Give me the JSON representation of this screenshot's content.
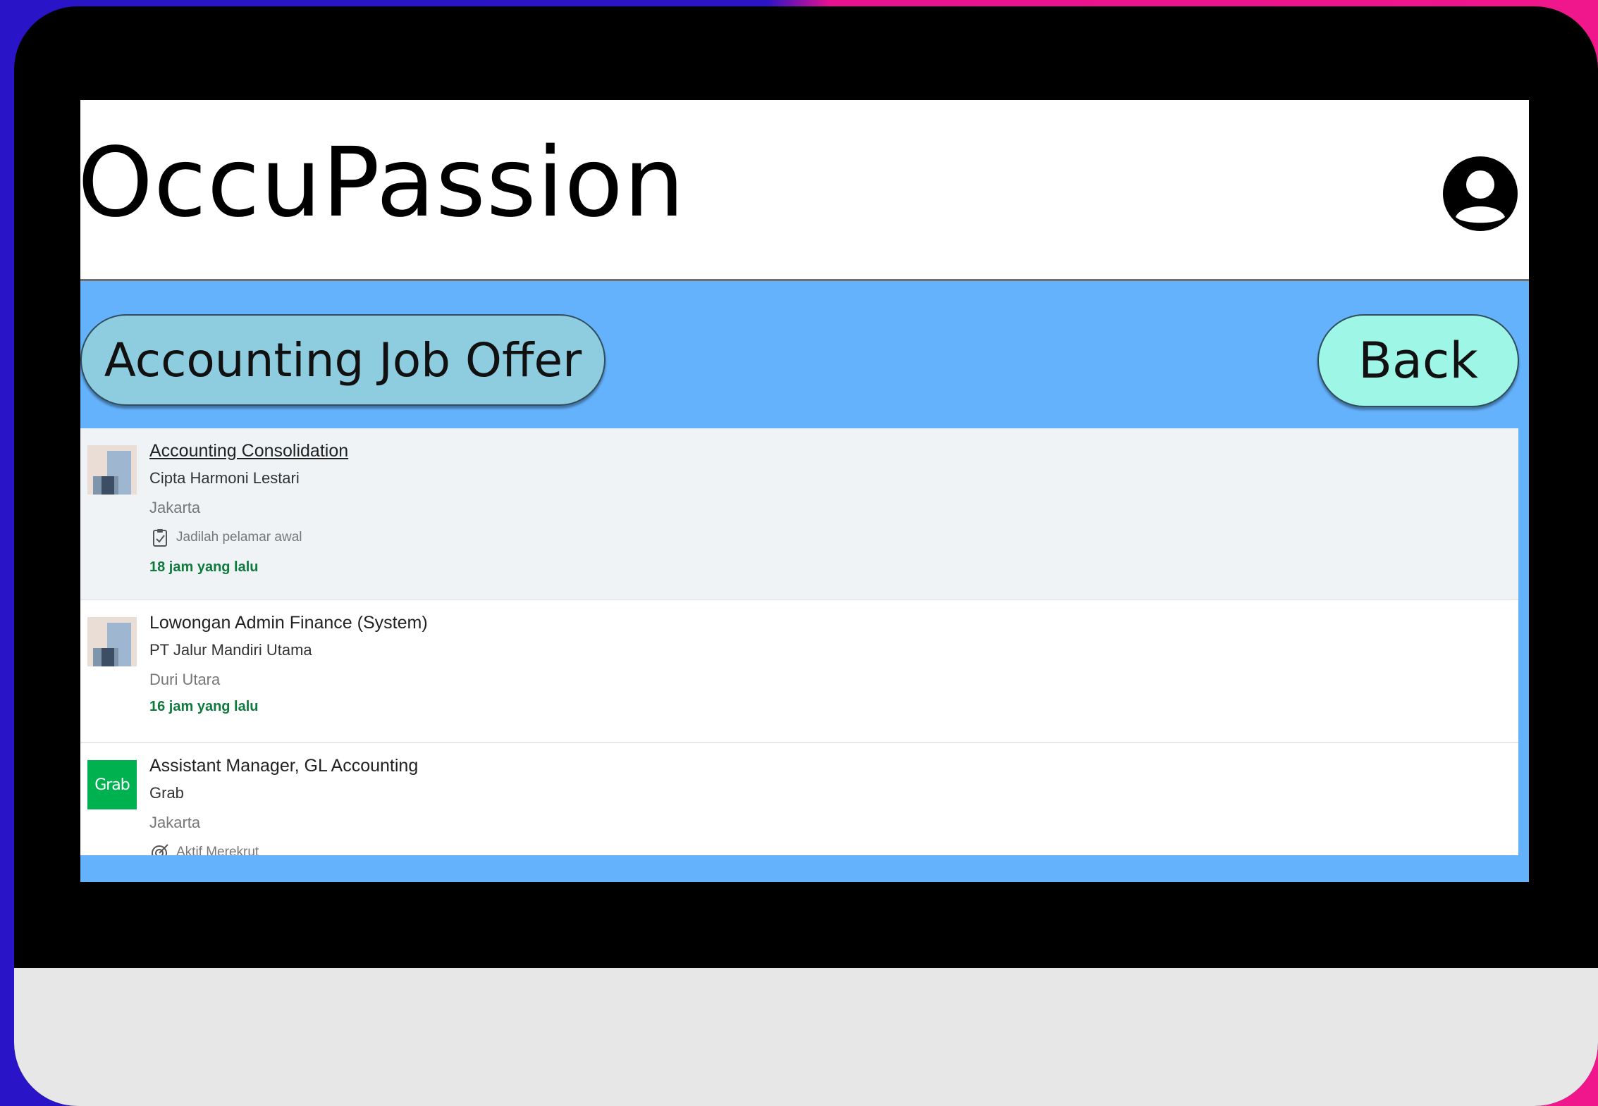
{
  "app": {
    "brand": "OccuPassion",
    "profile_icon": "user-circle-icon"
  },
  "page": {
    "title": "Accounting Job Offer",
    "back_label": "Back"
  },
  "jobs": [
    {
      "title": "Accounting Consolidation",
      "company": "Cipta Harmoni Lestari",
      "location": "Jakarta",
      "insight": "Jadilah pelamar awal",
      "insight_icon": "clipboard-check-icon",
      "posted": "18 jam yang lalu",
      "logo": "building-logo"
    },
    {
      "title": "Lowongan Admin Finance (System)",
      "company": "PT Jalur Mandiri Utama",
      "location": "Duri Utara",
      "posted": "16 jam yang lalu",
      "logo": "building-logo"
    },
    {
      "title": "Assistant Manager, GL Accounting",
      "company": "Grab",
      "location": "Jakarta",
      "insight": "Aktif Merekrut",
      "insight_icon": "target-icon",
      "logo_text": "Grab"
    }
  ],
  "colors": {
    "screen_bg": "#65b2fc",
    "title_pill": "#8ecce0",
    "back_button": "#9ef6e6",
    "posted_green": "#107a3e",
    "grab_green": "#00b14f"
  }
}
